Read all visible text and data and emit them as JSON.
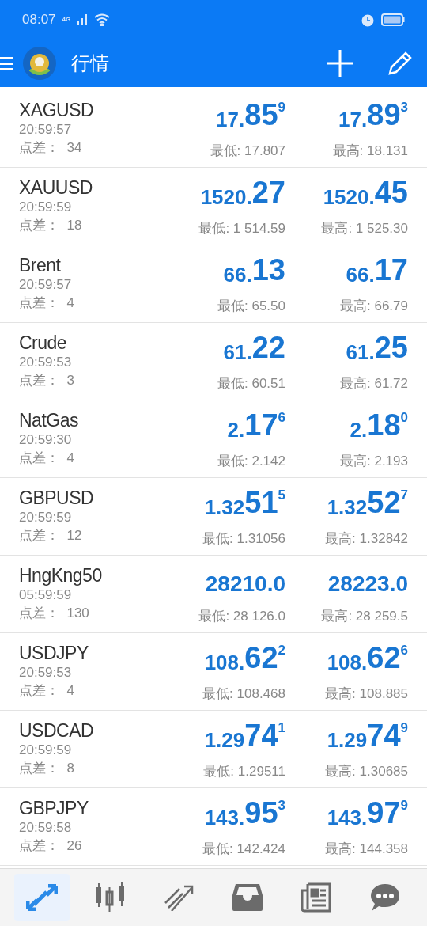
{
  "status_bar": {
    "time": "08:07",
    "network": "4G"
  },
  "app_bar": {
    "title": "行情"
  },
  "quotes": [
    {
      "symbol": "XAGUSD",
      "time": "20:59:57",
      "spread": "点差：  34",
      "bid": {
        "small": "17.",
        "big": "85",
        "sup": "9"
      },
      "ask": {
        "small": "17.",
        "big": "89",
        "sup": "3"
      },
      "low": "最低: 17.807",
      "high": "最高: 18.131"
    },
    {
      "symbol": "XAUUSD",
      "time": "20:59:59",
      "spread": "点差：  18",
      "bid": {
        "small": "1520.",
        "big": "27"
      },
      "ask": {
        "small": "1520.",
        "big": "45"
      },
      "low": "最低: 1 514.59",
      "high": "最高: 1 525.30"
    },
    {
      "symbol": "Brent",
      "time": "20:59:57",
      "spread": "点差：  4",
      "bid": {
        "small": "66.",
        "big": "13"
      },
      "ask": {
        "small": "66.",
        "big": "17"
      },
      "low": "最低: 65.50",
      "high": "最高: 66.79"
    },
    {
      "symbol": "Crude",
      "time": "20:59:53",
      "spread": "点差：  3",
      "bid": {
        "small": "61.",
        "big": "22"
      },
      "ask": {
        "small": "61.",
        "big": "25"
      },
      "low": "最低: 60.51",
      "high": "最高: 61.72"
    },
    {
      "symbol": "NatGas",
      "time": "20:59:30",
      "spread": "点差：  4",
      "bid": {
        "small": "2.",
        "big": "17",
        "sup": "6"
      },
      "ask": {
        "small": "2.",
        "big": "18",
        "sup": "0"
      },
      "low": "最低: 2.142",
      "high": "最高: 2.193"
    },
    {
      "symbol": "GBPUSD",
      "time": "20:59:59",
      "spread": "点差：  12",
      "bid": {
        "small": "1.32",
        "big": "51",
        "sup": "5"
      },
      "ask": {
        "small": "1.32",
        "big": "52",
        "sup": "7"
      },
      "low": "最低: 1.31056",
      "high": "最高: 1.32842"
    },
    {
      "symbol": "HngKng50",
      "time": "05:59:59",
      "spread": "点差：  130",
      "bid": {
        "small": "28210.0"
      },
      "ask": {
        "small": "28223.0"
      },
      "low": "最低: 28 126.0",
      "high": "最高: 28 259.5"
    },
    {
      "symbol": "USDJPY",
      "time": "20:59:53",
      "spread": "点差：  4",
      "bid": {
        "small": "108.",
        "big": "62",
        "sup": "2"
      },
      "ask": {
        "small": "108.",
        "big": "62",
        "sup": "6"
      },
      "low": "最低: 108.468",
      "high": "最高: 108.885"
    },
    {
      "symbol": "USDCAD",
      "time": "20:59:59",
      "spread": "点差：  8",
      "bid": {
        "small": "1.29",
        "big": "74",
        "sup": "1"
      },
      "ask": {
        "small": "1.29",
        "big": "74",
        "sup": "9"
      },
      "low": "最低: 1.29511",
      "high": "最高: 1.30685"
    },
    {
      "symbol": "GBPJPY",
      "time": "20:59:58",
      "spread": "点差：  26",
      "bid": {
        "small": "143.",
        "big": "95",
        "sup": "3"
      },
      "ask": {
        "small": "143.",
        "big": "97",
        "sup": "9"
      },
      "low": "最低: 142.424",
      "high": "最高: 144.358"
    }
  ],
  "bottom_nav": [
    {
      "kind": "quotes",
      "selected": true
    },
    {
      "kind": "chart",
      "selected": false
    },
    {
      "kind": "trade",
      "selected": false
    },
    {
      "kind": "history",
      "selected": false
    },
    {
      "kind": "news",
      "selected": false
    },
    {
      "kind": "chat",
      "selected": false
    }
  ]
}
